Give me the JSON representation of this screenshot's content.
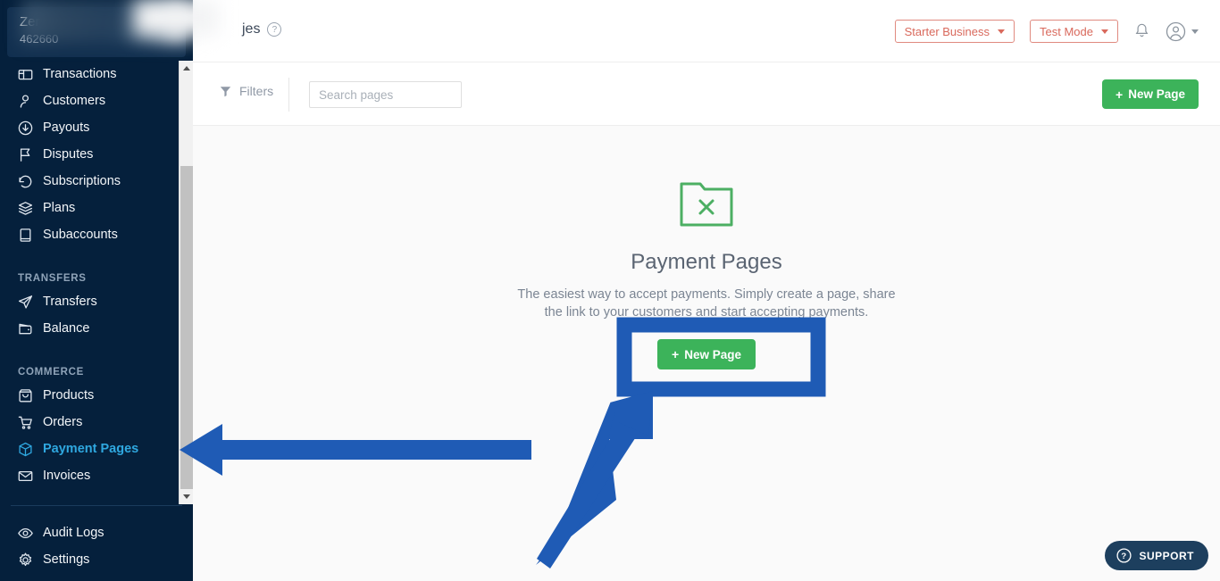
{
  "brand": {
    "name": "Zer",
    "account_id": "462660"
  },
  "sidebar": {
    "items": [
      {
        "label": "Transactions",
        "icon": "card-icon",
        "type": "item",
        "active": false
      },
      {
        "label": "Customers",
        "icon": "person-icon",
        "type": "item",
        "active": false
      },
      {
        "label": "Payouts",
        "icon": "download-circle-icon",
        "type": "item",
        "active": false
      },
      {
        "label": "Disputes",
        "icon": "flag-icon",
        "type": "item",
        "active": false
      },
      {
        "label": "Subscriptions",
        "icon": "refresh-icon",
        "type": "item",
        "active": false
      },
      {
        "label": "Plans",
        "icon": "layers-icon",
        "type": "item",
        "active": false
      },
      {
        "label": "Subaccounts",
        "icon": "book-icon",
        "type": "item",
        "active": false
      },
      {
        "label": "TRANSFERS",
        "icon": "",
        "type": "section",
        "active": false
      },
      {
        "label": "Transfers",
        "icon": "send-icon",
        "type": "item",
        "active": false
      },
      {
        "label": "Balance",
        "icon": "wallet-icon",
        "type": "item",
        "active": false
      },
      {
        "label": "COMMERCE",
        "icon": "",
        "type": "section",
        "active": false
      },
      {
        "label": "Products",
        "icon": "bag-icon",
        "type": "item",
        "active": false
      },
      {
        "label": "Orders",
        "icon": "cart-icon",
        "type": "item",
        "active": false
      },
      {
        "label": "Payment Pages",
        "icon": "box-icon",
        "type": "item",
        "active": true
      },
      {
        "label": "Invoices",
        "icon": "envelope-icon",
        "type": "item",
        "active": false
      }
    ],
    "bottom_items": [
      {
        "label": "Audit Logs",
        "icon": "eye-icon"
      },
      {
        "label": "Settings",
        "icon": "gear-icon"
      }
    ]
  },
  "topbar": {
    "page_title": "jes",
    "help_icon": "question-mark-icon",
    "business_selector": "Starter Business",
    "mode_selector": "Test Mode",
    "notifications_icon": "bell-icon",
    "avatar_icon": "user-avatar-icon"
  },
  "toolbar": {
    "filters_label": "Filters",
    "filters_icon": "funnel-icon",
    "search_placeholder": "Search pages",
    "search_value": "",
    "new_page_label": "New Page",
    "plus_icon": "plus-icon"
  },
  "empty_state": {
    "folder_icon": "folder-x-icon",
    "title": "Payment Pages",
    "description": "The easiest way to accept payments. Simply create a page, share the link to your customers and start accepting payments.",
    "new_page_label": "New Page",
    "plus_icon": "plus-icon"
  },
  "support": {
    "label": "SUPPORT",
    "icon": "question-circle-icon"
  },
  "colors": {
    "sidebar_bg": "#05203c",
    "sidebar_active": "#2fa8e0",
    "green_button": "#3cb35a",
    "red_outline": "#d9695c",
    "annotation_blue": "#1f5bb5",
    "folder_green": "#4caf63",
    "support_bg": "#1d3f5e",
    "main_bg": "#fafafa"
  },
  "annotations": {
    "highlight_box": "new-page-button-highlight",
    "arrow_left": "arrow-pointing-to-payment-pages-nav",
    "arrow_diagonal": "arrow-pointing-to-new-page-button"
  }
}
